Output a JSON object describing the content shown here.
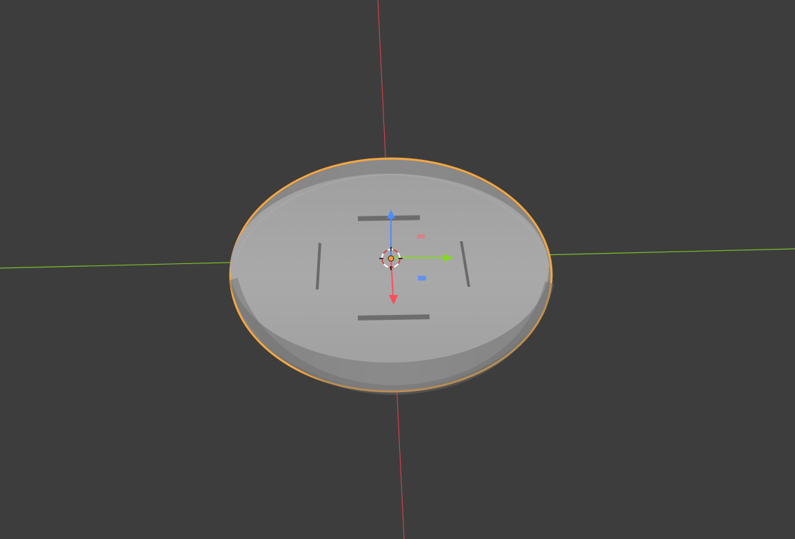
{
  "viewport": {
    "name": "3D Viewport",
    "background_color": "#3d3d3d"
  },
  "axes": {
    "x_axis_color": "#d9434a",
    "y_axis_color": "#7fbf2b",
    "z_axis_color": "#3b82f6"
  },
  "selected_object": {
    "shape": "cylindrical tray",
    "outline_color": "#f4a742",
    "inner_surface_color": "#a5a5a5",
    "rim_color": "#7c7c7c",
    "inner_parts": [
      "rail-top",
      "rail-bottom",
      "clip-left",
      "clip-right"
    ]
  },
  "gizmo": {
    "icons": [
      "3d-cursor-icon",
      "origin-point-icon",
      "move-x-arrow-icon",
      "move-y-arrow-icon",
      "move-z-arrow-icon",
      "plane-xz-handle-icon",
      "plane-xy-handle-icon"
    ],
    "x_arrow_color": "#ff4d5a",
    "y_arrow_color": "#86d627",
    "z_arrow_color": "#4d8dff",
    "origin_color": "#ff9d2a"
  }
}
